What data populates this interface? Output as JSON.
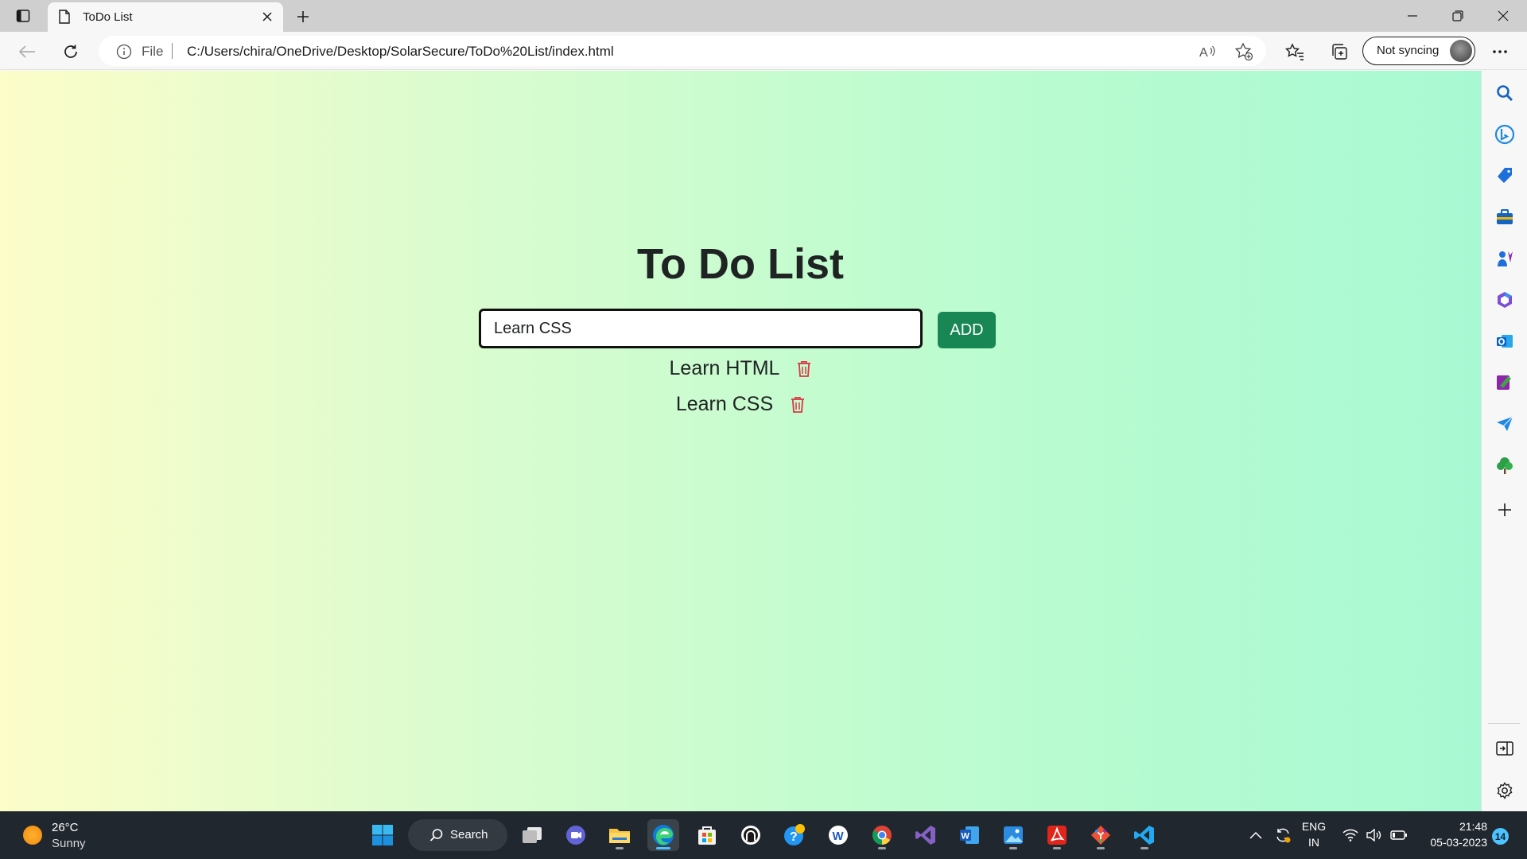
{
  "browser": {
    "tab_title": "ToDo List",
    "file_label": "File",
    "url": "C:/Users/chira/OneDrive/Desktop/SolarSecure/ToDo%20List/index.html",
    "profile_label": "Not syncing"
  },
  "page": {
    "title": "To Do List",
    "input_value": "Learn CSS",
    "add_label": "ADD",
    "todos": [
      {
        "text": "Learn HTML"
      },
      {
        "text": "Learn CSS"
      }
    ],
    "colors": {
      "add_button": "#198754",
      "trash": "#dc3545",
      "gradient_start": "#fcfdc9",
      "gradient_end": "#a8f9d3"
    }
  },
  "sidebar": {
    "icons": [
      "search-icon",
      "bing-icon",
      "shopping-icon",
      "tools-icon",
      "games-icon",
      "microsoft-365-icon",
      "outlook-icon",
      "designer-icon",
      "send-icon",
      "tree-icon",
      "add-icon",
      "split-screen-icon",
      "settings-icon"
    ]
  },
  "taskbar": {
    "weather_temp": "26°C",
    "weather_desc": "Sunny",
    "search_label": "Search",
    "lang_primary": "ENG",
    "lang_secondary": "IN",
    "time": "21:48",
    "date": "05-03-2023",
    "notifications": "14"
  }
}
